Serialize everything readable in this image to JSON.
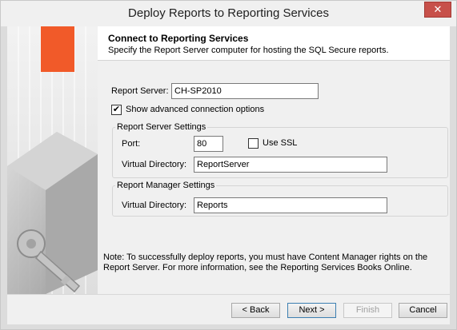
{
  "window": {
    "title": "Deploy Reports to Reporting Services",
    "close_label": "✕"
  },
  "header": {
    "title": "Connect to Reporting Services",
    "subtitle": "Specify the Report Server computer for hosting the SQL Secure reports."
  },
  "form": {
    "report_server_label": "Report Server:",
    "report_server_value": "CH-SP2010",
    "advanced_checkbox_label": "Show advanced connection options",
    "advanced_checked": true,
    "check_mark": "✔"
  },
  "report_server_settings": {
    "title": "Report Server Settings",
    "port_label": "Port:",
    "port_value": "80",
    "ssl_label": "Use SSL",
    "ssl_checked": false,
    "vdir_label": "Virtual Directory:",
    "vdir_value": "ReportServer"
  },
  "report_manager_settings": {
    "title": "Report Manager Settings",
    "vdir_label": "Virtual Directory:",
    "vdir_value": "Reports"
  },
  "note": "Note:  To successfully deploy reports, you must have Content Manager rights on the Report Server.  For more information, see the Reporting Services Books Online.",
  "buttons": {
    "back": "< Back",
    "next": "Next >",
    "finish": "Finish",
    "cancel": "Cancel"
  },
  "side_panel": {
    "icon": "key-icon",
    "accent_color": "#f15a29"
  }
}
